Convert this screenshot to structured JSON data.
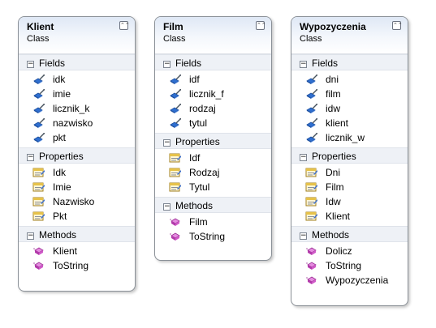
{
  "classes": [
    {
      "name": "Klient",
      "kind": "Class",
      "sections": [
        {
          "title": "Fields",
          "icon": "field-icon",
          "items": [
            "idk",
            "imie",
            "licznik_k",
            "nazwisko",
            "pkt"
          ]
        },
        {
          "title": "Properties",
          "icon": "property-icon",
          "items": [
            "Idk",
            "Imie",
            "Nazwisko",
            "Pkt"
          ]
        },
        {
          "title": "Methods",
          "icon": "method-icon",
          "items": [
            "Klient",
            "ToString"
          ]
        }
      ]
    },
    {
      "name": "Film",
      "kind": "Class",
      "sections": [
        {
          "title": "Fields",
          "icon": "field-icon",
          "items": [
            "idf",
            "licznik_f",
            "rodzaj",
            "tytul"
          ]
        },
        {
          "title": "Properties",
          "icon": "property-icon",
          "items": [
            "Idf",
            "Rodzaj",
            "Tytul"
          ]
        },
        {
          "title": "Methods",
          "icon": "method-icon",
          "items": [
            "Film",
            "ToString"
          ]
        }
      ]
    },
    {
      "name": "Wypozyczenia",
      "kind": "Class",
      "sections": [
        {
          "title": "Fields",
          "icon": "field-icon",
          "items": [
            "dni",
            "film",
            "idw",
            "klient",
            "licznik_w"
          ]
        },
        {
          "title": "Properties",
          "icon": "property-icon",
          "items": [
            "Dni",
            "Film",
            "Idw",
            "Klient"
          ]
        },
        {
          "title": "Methods",
          "icon": "method-icon",
          "items": [
            "Dolicz",
            "ToString",
            "Wypozyczenia"
          ]
        }
      ]
    }
  ],
  "collapse_glyph": "⌃⌃",
  "section_toggle_glyph": "−",
  "colors": {
    "header_gradient_top": "#dfe8f5",
    "section_header_bg": "#eef1f6",
    "border": "#8a9097",
    "field_icon": "#2f6fd0",
    "property_icon": "#c9a43a",
    "method_icon": "#c04ab6"
  }
}
